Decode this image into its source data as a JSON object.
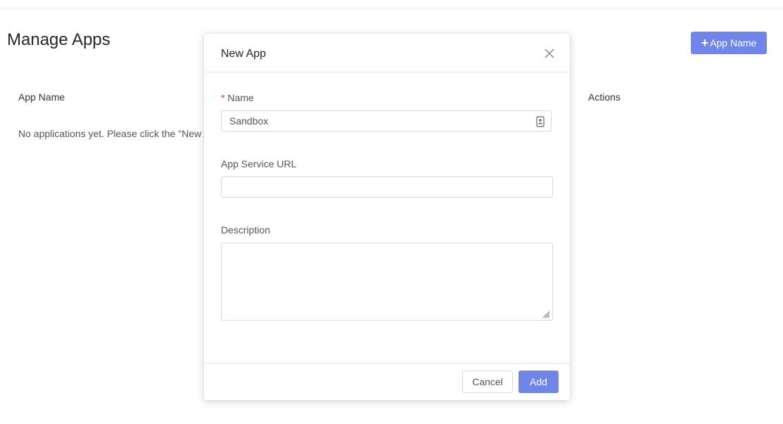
{
  "page": {
    "title": "Manage Apps",
    "add_button_label": "App Name",
    "columns": [
      "App Name",
      "Actions"
    ],
    "empty_message": "No applications yet. Please click the \"New A"
  },
  "modal": {
    "title": "New App",
    "fields": {
      "name": {
        "label": "Name",
        "required_marker": "*",
        "value": "Sandbox"
      },
      "service_url": {
        "label": "App Service URL",
        "value": ""
      },
      "description": {
        "label": "Description",
        "value": ""
      }
    },
    "cancel_label": "Cancel",
    "submit_label": "Add"
  },
  "icons": {
    "plus": "plus-icon",
    "close": "close-icon",
    "contact": "contact-card-icon",
    "resize": "resize-handle-icon"
  },
  "colors": {
    "primary": "#6f86e8",
    "required": "#e03e3e",
    "border": "#d9d9d9"
  }
}
